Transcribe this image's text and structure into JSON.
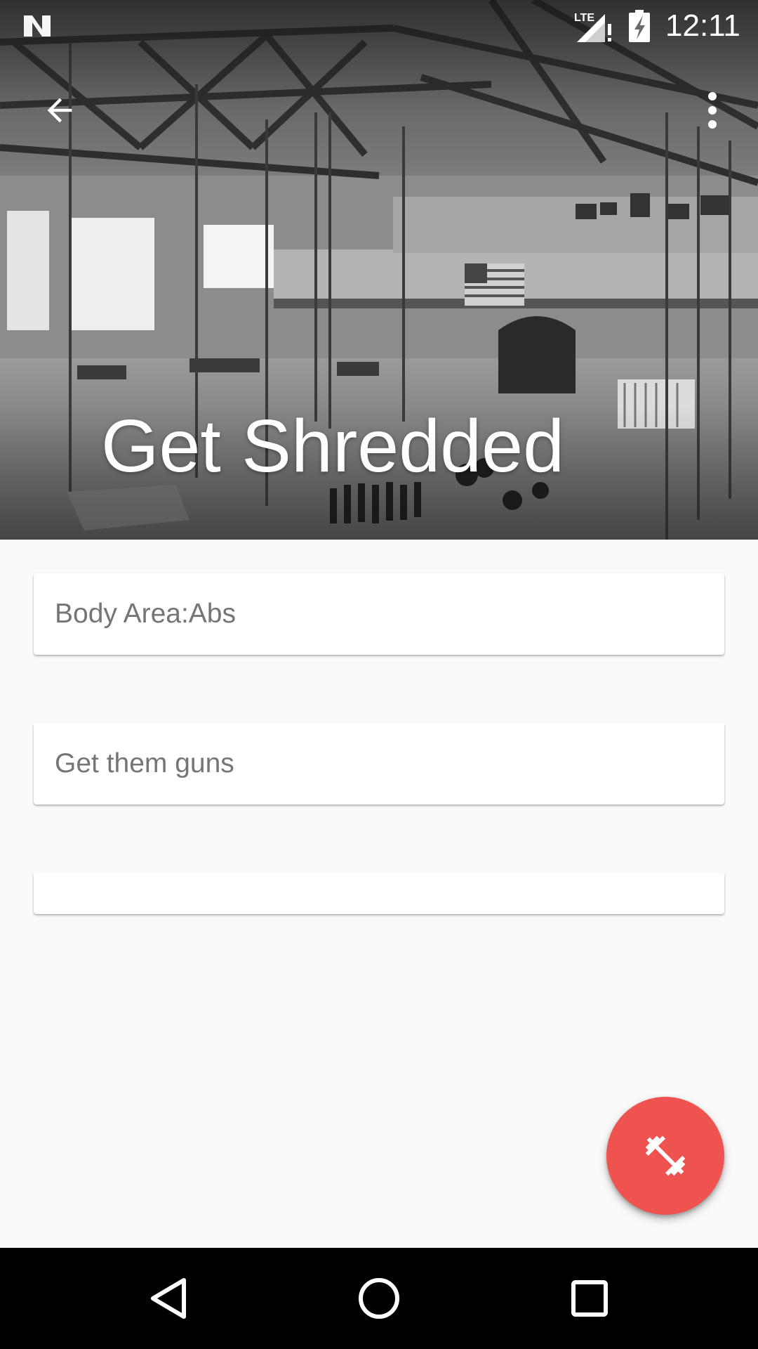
{
  "status_bar": {
    "time": "12:11",
    "icons": [
      "n-logo-icon",
      "lte-signal-icon",
      "battery-icon"
    ]
  },
  "toolbar": {
    "back_icon": "arrow-left-icon",
    "overflow_icon": "more-vert-icon"
  },
  "header": {
    "title": "Get Shredded"
  },
  "cards": [
    {
      "text": "Body Area:Abs"
    },
    {
      "text": "Get them guns"
    },
    {
      "text": ""
    }
  ],
  "fab": {
    "icon": "dumbbell-icon",
    "color": "#ef5350"
  },
  "nav_bar": {
    "icons": [
      "nav-back-icon",
      "nav-home-icon",
      "nav-recents-icon"
    ]
  },
  "colors": {
    "background": "#fafafa",
    "card": "#ffffff",
    "card_text": "#757575",
    "accent": "#ef5350",
    "nav_bar": "#000000"
  }
}
